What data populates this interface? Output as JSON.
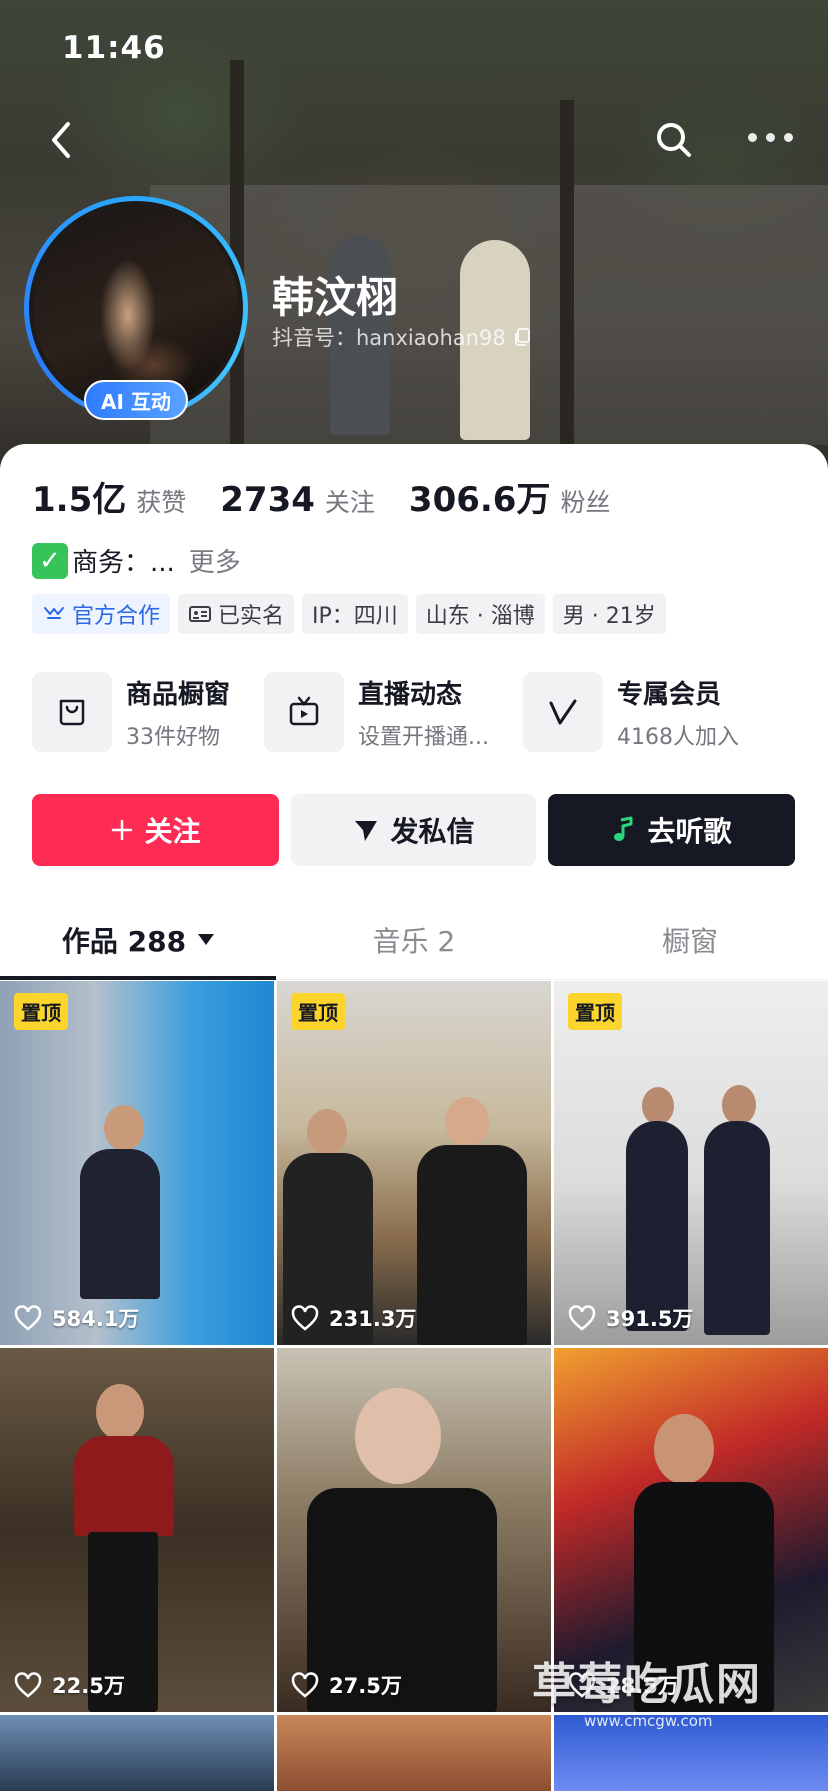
{
  "status_bar": {
    "time": "11:46"
  },
  "profile": {
    "nickname": "韩汶栩",
    "douyin_id": "抖音号：hanxiaohan98",
    "ai_badge": "AI 互动"
  },
  "stats": [
    {
      "value": "1.5亿",
      "label": "获赞"
    },
    {
      "value": "2734",
      "label": "关注"
    },
    {
      "value": "306.6万",
      "label": "粉丝"
    }
  ],
  "bio": {
    "text": "商务：...",
    "more": "更多",
    "icon": "check-mark-icon"
  },
  "tags": [
    {
      "label": "官方合作",
      "icon": "official-cooperation-icon"
    },
    {
      "label": "已实名",
      "icon": "id-card-icon"
    },
    {
      "label": "IP：四川"
    },
    {
      "label": "山东 · 淄博"
    },
    {
      "label": "男 · 21岁"
    }
  ],
  "services": [
    {
      "title": "商品橱窗",
      "subtitle": "33件好物",
      "icon": "shopping-bag-icon"
    },
    {
      "title": "直播动态",
      "subtitle": "设置开播通...",
      "icon": "tv-icon"
    },
    {
      "title": "专属会员",
      "subtitle": "4168人加入",
      "icon": "membership-v-icon"
    }
  ],
  "actions": {
    "follow": "关注",
    "message": "发私信",
    "music": "去听歌"
  },
  "tabs": [
    {
      "label": "作品 288"
    },
    {
      "label": "音乐 2"
    },
    {
      "label": "橱窗"
    }
  ],
  "videos": [
    {
      "pinned": "置顶",
      "likes": "584.1万"
    },
    {
      "pinned": "置顶",
      "likes": "231.3万"
    },
    {
      "pinned": "置顶",
      "likes": "391.5万"
    },
    {
      "pinned": "",
      "likes": "22.5万"
    },
    {
      "pinned": "",
      "likes": "27.5万"
    },
    {
      "pinned": "",
      "likes": "28.5万"
    }
  ],
  "watermark": {
    "text": "草莓吃瓜网",
    "url": "www.cmcgw.com"
  },
  "colors": {
    "accent": "#fe2c55",
    "dark": "#161823",
    "pin": "#fbd42c",
    "avatar_ring": "#2aa8ff"
  }
}
